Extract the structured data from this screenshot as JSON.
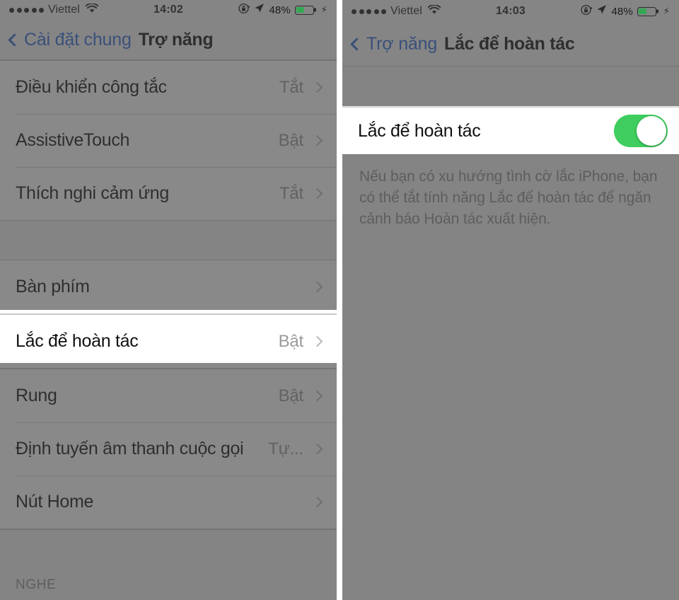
{
  "left_panel": {
    "status_bar": {
      "signal_dots": 5,
      "carrier": "Viettel",
      "wifi_icon": "wifi-icon",
      "time": "14:02",
      "rotation_lock_icon": "rotation-lock-icon",
      "location_icon": "location-arrow-icon",
      "battery_percent": "48%",
      "battery_level": 48,
      "charging_icon": "lightning-bolt-icon"
    },
    "nav": {
      "back_icon": "chevron-left-icon",
      "back_label": "Cài đặt chung",
      "title": "Trợ năng"
    },
    "groups": [
      {
        "rows": [
          {
            "label": "Điều khiển công tắc",
            "value": "Tắt",
            "accessory": "chevron-right-icon"
          },
          {
            "label": "AssistiveTouch",
            "value": "Bật",
            "accessory": "chevron-right-icon"
          },
          {
            "label": "Thích nghi cảm ứng",
            "value": "Tắt",
            "accessory": "chevron-right-icon"
          }
        ]
      },
      {
        "rows": [
          {
            "label": "Bàn phím",
            "value": "",
            "accessory": "chevron-right-icon"
          }
        ]
      },
      {
        "highlighted": true,
        "rows": [
          {
            "label": "Lắc để hoàn tác",
            "value": "Bật",
            "accessory": "chevron-right-icon"
          }
        ]
      },
      {
        "rows": [
          {
            "label": "Rung",
            "value": "Bật",
            "accessory": "chevron-right-icon"
          },
          {
            "label": "Định tuyến âm thanh cuộc gọi",
            "value": "Tự...",
            "accessory": "chevron-right-icon"
          },
          {
            "label": "Nút Home",
            "value": "",
            "accessory": "chevron-right-icon"
          }
        ]
      }
    ],
    "section_header": "NGHE"
  },
  "right_panel": {
    "status_bar": {
      "signal_dots": 5,
      "carrier": "Viettel",
      "wifi_icon": "wifi-icon",
      "time": "14:03",
      "rotation_lock_icon": "rotation-lock-icon",
      "location_icon": "location-arrow-icon",
      "battery_percent": "48%",
      "battery_level": 48,
      "charging_icon": "lightning-bolt-icon"
    },
    "nav": {
      "back_icon": "chevron-left-icon",
      "back_label": "Trợ năng",
      "title": "Lắc để hoàn tác"
    },
    "toggle_row": {
      "label": "Lắc để hoàn tác",
      "state": "on"
    },
    "footnote": "Nếu bạn có xu hướng tình cờ lắc iPhone, bạn có thể tắt tính năng Lắc để hoàn tác để ngăn cảnh báo Hoàn tác xuất hiện."
  },
  "colors": {
    "accent_blue": "#2f6ad6",
    "toggle_green": "#3ecd5e",
    "battery_green": "#34a853",
    "row_bg": "#ffffff",
    "page_bg": "#f1f1f1",
    "dim_overlay": "rgba(64,64,64,0.62)"
  }
}
